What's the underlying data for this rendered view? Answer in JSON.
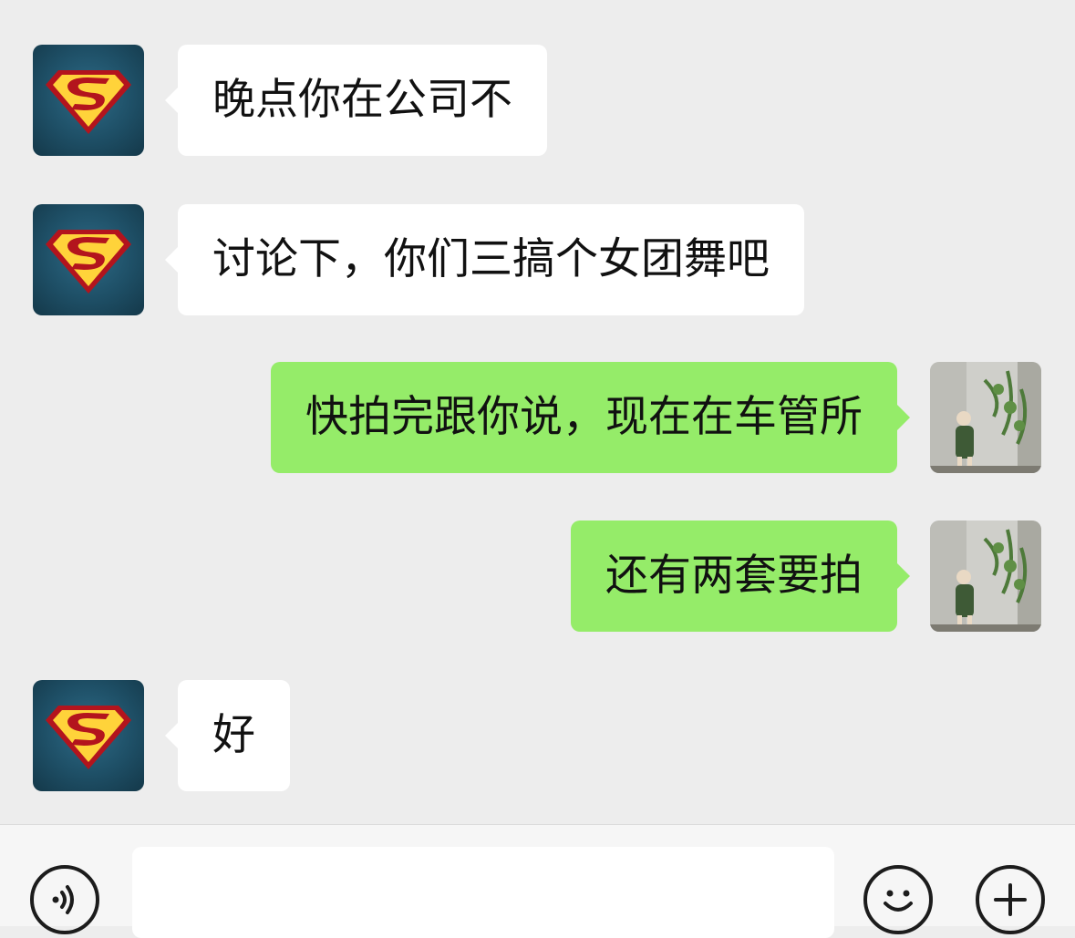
{
  "messages": [
    {
      "side": "left",
      "avatar": "superman-logo-avatar",
      "text": "晚点你在公司不"
    },
    {
      "side": "left",
      "avatar": "superman-logo-avatar",
      "text": "讨论下，你们三搞个女团舞吧"
    },
    {
      "side": "right",
      "avatar": "girl-photo-avatar",
      "text": "快拍完跟你说，现在在车管所"
    },
    {
      "side": "right",
      "avatar": "girl-photo-avatar",
      "text": "还有两套要拍"
    },
    {
      "side": "left",
      "avatar": "superman-logo-avatar",
      "text": "好"
    }
  ],
  "input_bar": {
    "voice_icon": "voice-icon",
    "emoji_icon": "emoji-icon",
    "more_icon": "plus-icon",
    "message_value": ""
  },
  "colors": {
    "background": "#ededed",
    "incoming_bubble": "#ffffff",
    "outgoing_bubble": "#95ec69"
  }
}
